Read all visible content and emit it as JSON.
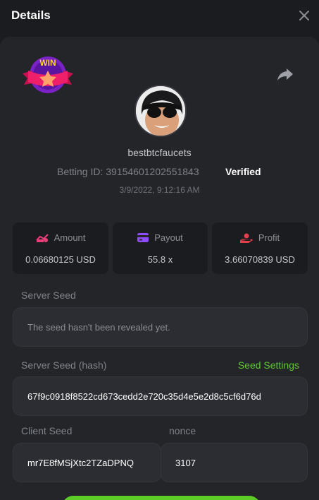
{
  "header": {
    "title": "Details"
  },
  "bet": {
    "username": "bestbtcfaucets",
    "betting_id": "Betting ID: 39154601202551843",
    "verified": "Verified",
    "datetime": "3/9/2022, 9:12:16 AM"
  },
  "stats": {
    "amount_label": "Amount",
    "amount_value": "0.06680125 USD",
    "payout_label": "Payout",
    "payout_value": "55.8 x",
    "profit_label": "Profit",
    "profit_value": "3.66070839 USD"
  },
  "server_seed": {
    "label": "Server Seed",
    "value": "The seed hasn't been revealed yet."
  },
  "server_seed_hash": {
    "label": "Server Seed (hash)",
    "settings_link": "Seed Settings",
    "value": "67f9c0918f8522cd673cedd2e720c35d4e5e2d8c5cf6d76d"
  },
  "client_seed": {
    "label": "Client Seed",
    "value": "mr7E8fMSjXtc2TZaDPNQ"
  },
  "nonce": {
    "label": "nonce",
    "value": "3107"
  },
  "badge": {
    "text": "WIN"
  },
  "colors": {
    "accent_green": "#5fc832",
    "amount_icon": "#e9407a",
    "payout_icon": "#8e4dff",
    "profit_icon": "#e53e4d"
  },
  "icons": {
    "close": "close-icon",
    "share": "share-icon",
    "badge": "win-badge-icon"
  }
}
